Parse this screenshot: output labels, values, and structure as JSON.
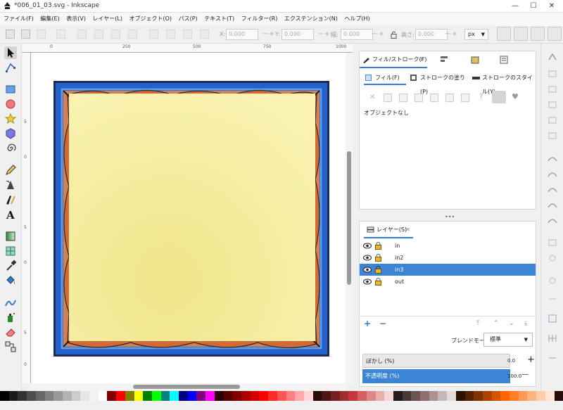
{
  "window": {
    "title": "*006_01_03.svg - Inkscape",
    "minimize": "—",
    "maximize": "☐",
    "close": "✕"
  },
  "menu": [
    "ファイル(F)",
    "編集(E)",
    "表示(V)",
    "レイヤー(L)",
    "オブジェクト(O)",
    "パス(P)",
    "テキスト(T)",
    "フィルター(R)",
    "エクステンション(N)",
    "ヘルプ(H)"
  ],
  "toolbar": {
    "x_label": "X:",
    "x_value": "0.000",
    "y_label": "Y:",
    "y_value": "0.000",
    "w_label": "幅:",
    "w_value": "0.000",
    "h_label": "高さ:",
    "h_value": "0.000",
    "unit": "px",
    "spin_minus": "−",
    "spin_plus": "+"
  },
  "ruler": {
    "h_ticks": [
      "0",
      "250",
      "500",
      "750",
      "1000"
    ],
    "v_ticks": [
      "5",
      "0",
      "5",
      "0",
      "5",
      "0"
    ]
  },
  "fill_stroke": {
    "tab_label": "フィル/ストローク(F)",
    "tab_close": "✕",
    "subtabs": [
      "フィル(F)",
      "ストロークの塗り(P)",
      "ストロークのスタイル(Y)"
    ],
    "unknown_icon": "?",
    "no_object": "オブジェクトなし"
  },
  "layers": {
    "tab_label": "レイヤー(S)",
    "tab_close": "✕",
    "items": [
      {
        "name": "in",
        "selected": false
      },
      {
        "name": "in2",
        "selected": false
      },
      {
        "name": "in3",
        "selected": true
      },
      {
        "name": "out",
        "selected": false
      }
    ],
    "add": "+",
    "remove": "−",
    "blend_label": "ブレンドモード:",
    "blend_value": "標準",
    "blur_label": "ぼかし (%)",
    "blur_value": "0.0",
    "opacity_label": "不透明度 (%)",
    "opacity_value": "100.0",
    "plus": "+",
    "minus": "—"
  },
  "colors": {
    "accent": "#2e7ad1",
    "paper": "#f7f0a8",
    "frame_blue": "#2260c8",
    "frame_orange": "#e8874a"
  },
  "palette": [
    "#000000",
    "#1a1a1a",
    "#333333",
    "#4d4d4d",
    "#666666",
    "#808080",
    "#999999",
    "#b3b3b3",
    "#cccccc",
    "#e6e6e6",
    "#f2f2f2",
    "#ffffff",
    "#800000",
    "#ff0000",
    "#808000",
    "#ffff00",
    "#008000",
    "#00ff00",
    "#008080",
    "#00ffff",
    "#000080",
    "#0000ff",
    "#800080",
    "#ff00ff",
    "#2b0000",
    "#550000",
    "#800000",
    "#aa0000",
    "#d40000",
    "#ff0000",
    "#ff2a2a",
    "#ff5555",
    "#ff8080",
    "#ffaaaa",
    "#ffd5d5",
    "#280b0b",
    "#501616",
    "#782121",
    "#a02c2c",
    "#c83737",
    "#d35f5f",
    "#de8787",
    "#e9afaf",
    "#f4d7d7",
    "#241c1c",
    "#483737",
    "#6c5353",
    "#916f6f",
    "#ac9393",
    "#c8b7b7",
    "#e3dbdb",
    "#2b1100",
    "#552200",
    "#803300",
    "#aa4400",
    "#d45500",
    "#ff6600",
    "#ff7f2a",
    "#ff9955",
    "#ffb380",
    "#ffccaa",
    "#ffe6d5",
    "#280b0b"
  ]
}
